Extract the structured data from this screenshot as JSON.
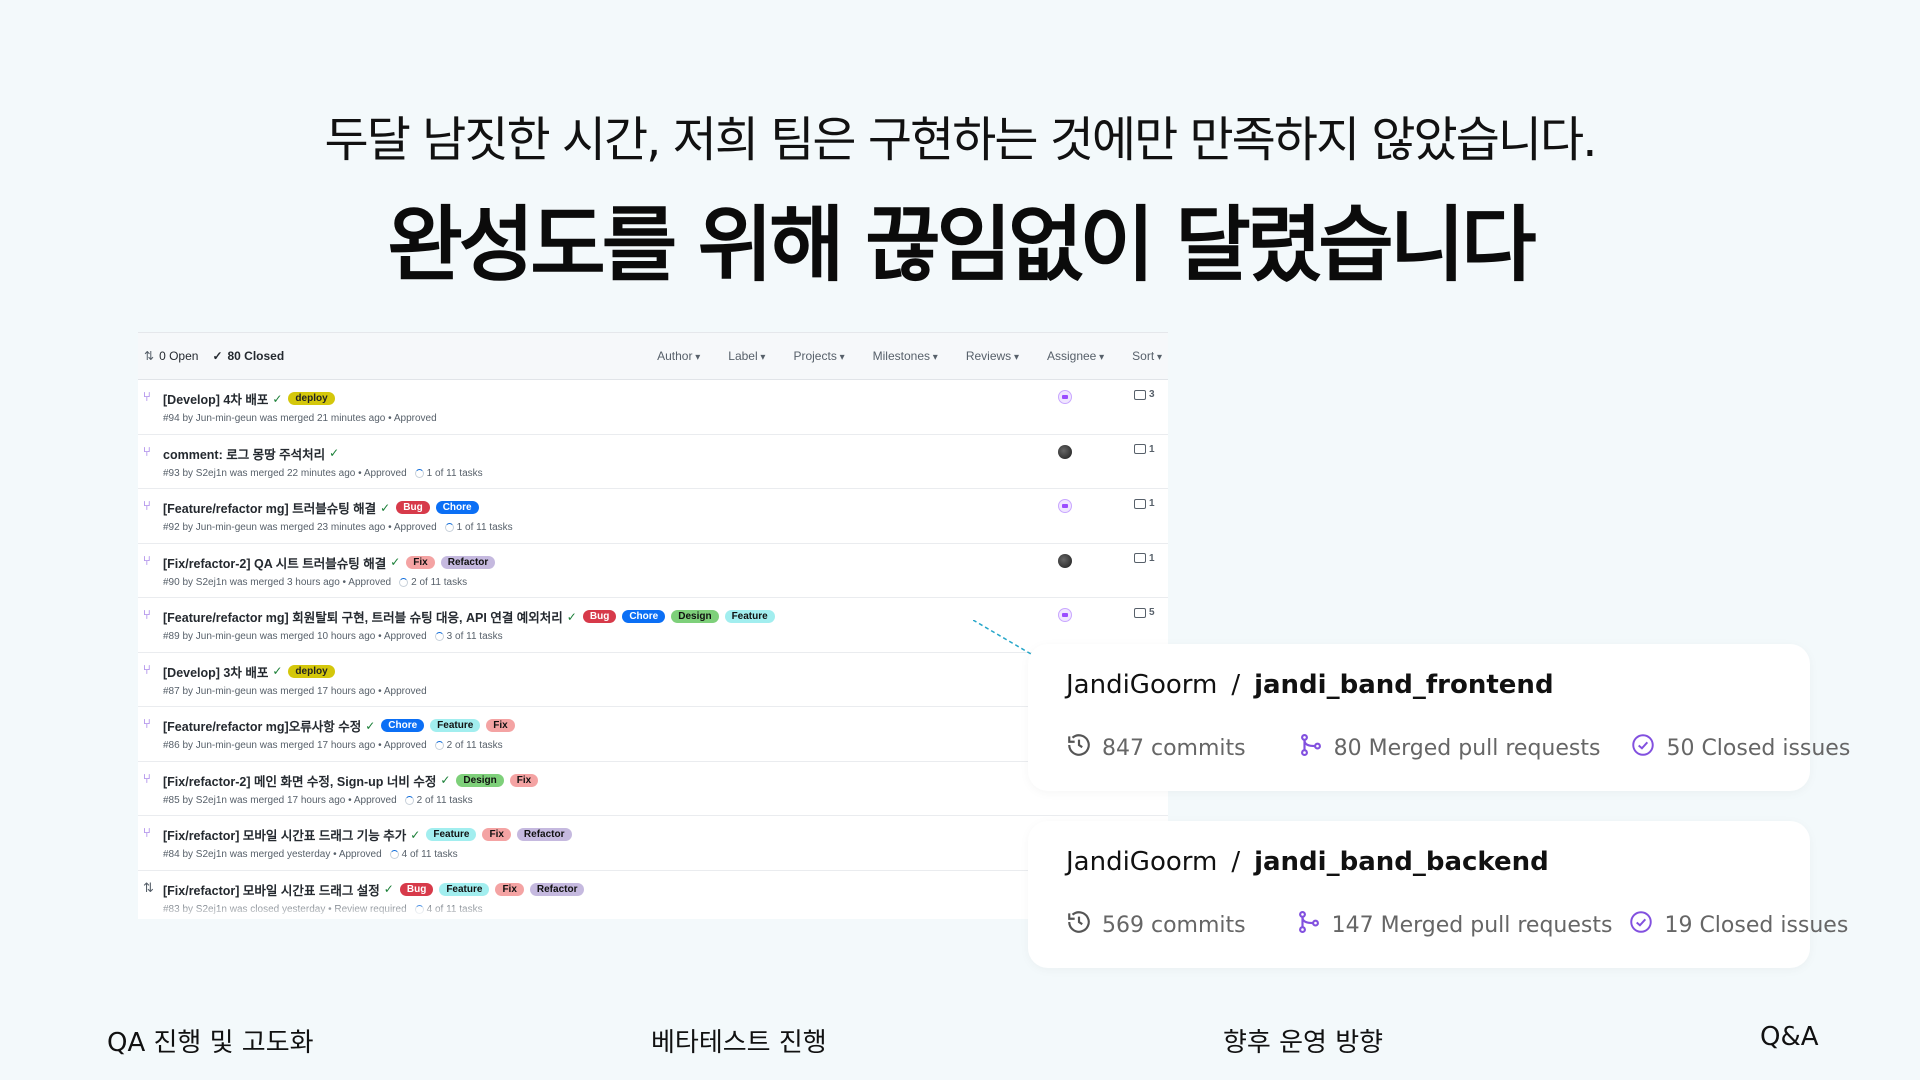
{
  "heading": {
    "subtitle": "두달 남짓한 시간, 저희 팀은 구현하는 것에만 만족하지 않았습니다.",
    "title": "완성도를 위해 끊임없이 달렸습니다"
  },
  "pr_list": {
    "open_label": "0 Open",
    "closed_label": "80 Closed",
    "filters": [
      "Author",
      "Label",
      "Projects",
      "Milestones",
      "Reviews",
      "Assignee",
      "Sort"
    ],
    "rows": [
      {
        "title": "[Develop] 4차 배포",
        "labels": [
          "deploy"
        ],
        "meta": "#94 by Jun-min-geun was merged 21 minutes ago • Approved",
        "tasks": "",
        "avatar": "purple",
        "comments": "3",
        "state": "merged"
      },
      {
        "title": "comment: 로그 몽땅 주석처리",
        "labels": [],
        "meta": "#93 by S2ej1n was merged 22 minutes ago • Approved",
        "tasks": "1 of 11 tasks",
        "avatar": "dark",
        "comments": "1",
        "state": "merged"
      },
      {
        "title": "[Feature/refactor mg] 트러블슈팅 해결",
        "labels": [
          "Bug",
          "Chore"
        ],
        "meta": "#92 by Jun-min-geun was merged 23 minutes ago • Approved",
        "tasks": "1 of 11 tasks",
        "avatar": "purple",
        "comments": "1",
        "state": "merged"
      },
      {
        "title": "[Fix/refactor-2] QA 시트 트러블슈팅 해결",
        "labels": [
          "Fix",
          "Refactor"
        ],
        "meta": "#90 by S2ej1n was merged 3 hours ago • Approved",
        "tasks": "2 of 11 tasks",
        "avatar": "dark",
        "comments": "1",
        "state": "merged"
      },
      {
        "title": "[Feature/refactor mg] 회원탈퇴 구현, 트러블 슈팅 대응, API 연결 예외처리",
        "labels": [
          "Bug",
          "Chore",
          "Design",
          "Feature"
        ],
        "meta": "#89 by Jun-min-geun was merged 10 hours ago • Approved",
        "tasks": "3 of 11 tasks",
        "avatar": "purple",
        "comments": "5",
        "state": "merged"
      },
      {
        "title": "[Develop] 3차 배포",
        "labels": [
          "deploy"
        ],
        "meta": "#87 by Jun-min-geun was merged 17 hours ago • Approved",
        "tasks": "",
        "avatar": "",
        "comments": "",
        "state": "merged"
      },
      {
        "title": "[Feature/refactor mg]오류사항 수정",
        "labels": [
          "Chore",
          "Feature",
          "Fix"
        ],
        "meta": "#86 by Jun-min-geun was merged 17 hours ago • Approved",
        "tasks": "2 of 11 tasks",
        "avatar": "",
        "comments": "",
        "state": "merged"
      },
      {
        "title": "[Fix/refactor-2] 메인 화면 수정, Sign-up 너비 수정",
        "labels": [
          "Design",
          "Fix"
        ],
        "meta": "#85 by S2ej1n was merged 17 hours ago • Approved",
        "tasks": "2 of 11 tasks",
        "avatar": "",
        "comments": "",
        "state": "merged"
      },
      {
        "title": "[Fix/refactor] 모바일 시간표 드래그 기능 추가",
        "labels": [
          "Feature",
          "Fix",
          "Refactor"
        ],
        "meta": "#84 by S2ej1n was merged yesterday • Approved",
        "tasks": "4 of 11 tasks",
        "avatar": "",
        "comments": "",
        "state": "merged"
      },
      {
        "title": "[Fix/refactor] 모바일 시간표 드래그 설정",
        "labels": [
          "Bug",
          "Feature",
          "Fix",
          "Refactor"
        ],
        "meta": "#83 by S2ej1n was closed yesterday • Review required",
        "tasks": "4 of 11 tasks",
        "avatar": "",
        "comments": "",
        "state": "closed"
      }
    ]
  },
  "repos": [
    {
      "owner": "JandiGoorm",
      "separator": "/",
      "name": "jandi_band_frontend",
      "commits": "847 commits",
      "prs": "80 Merged pull requests",
      "issues": "50 Closed issues"
    },
    {
      "owner": "JandiGoorm",
      "separator": "/",
      "name": "jandi_band_backend",
      "commits": "569 commits",
      "prs": "147 Merged pull requests",
      "issues": "19 Closed  issues"
    }
  ],
  "nav": [
    "QA 진행 및 고도화",
    "베타테스트 진행",
    "향후 운영 방향",
    "Q&A"
  ],
  "colors": {
    "background": "#f3f9fb",
    "merged_icon": "#8250df",
    "stat_icon": "#8250df"
  }
}
